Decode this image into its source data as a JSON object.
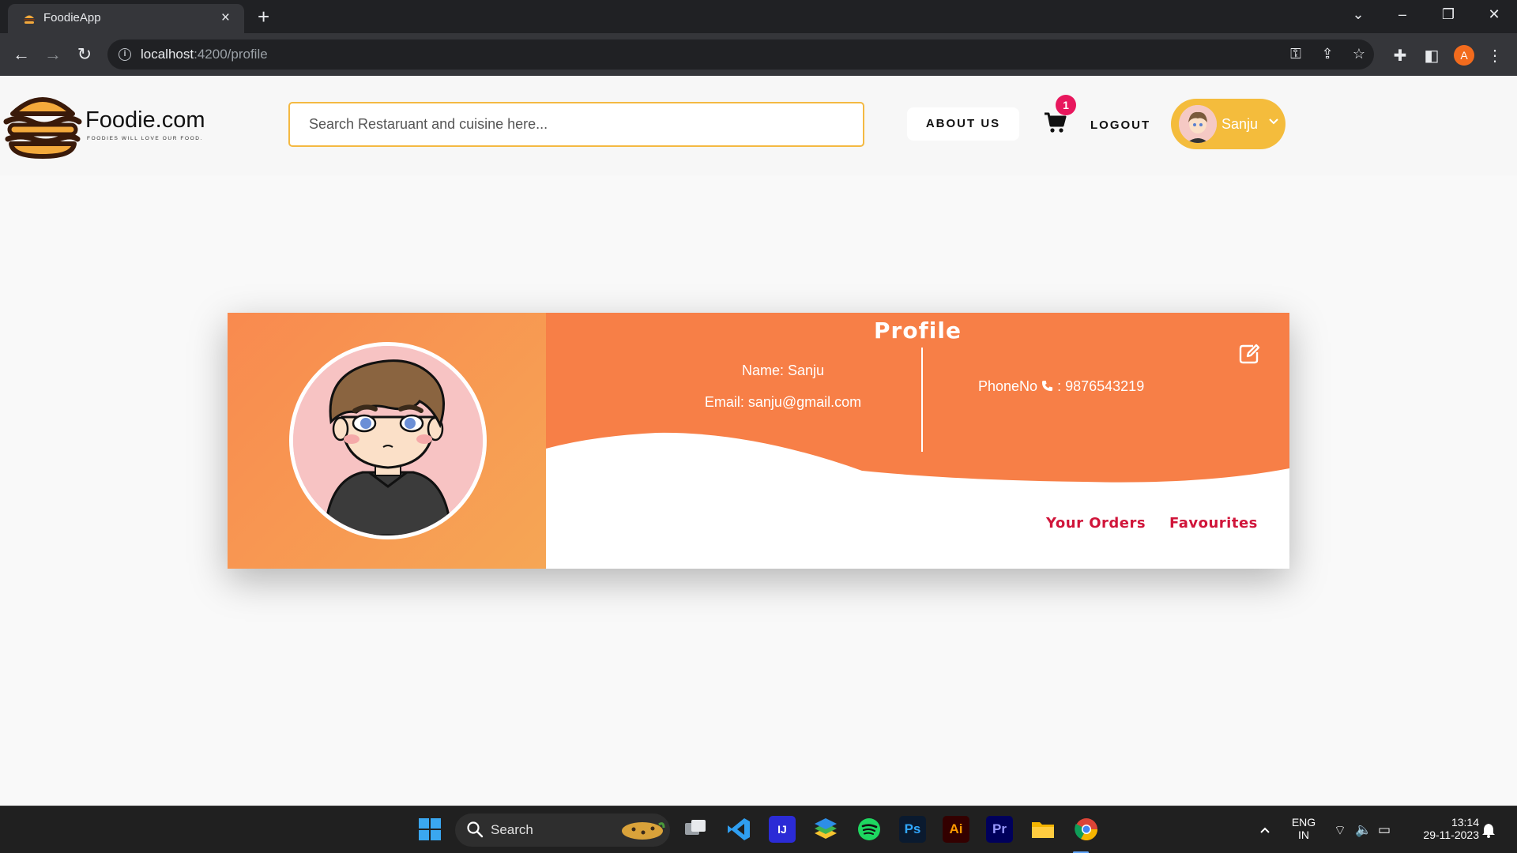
{
  "browser": {
    "tab_title": "FoodieApp",
    "url_host": "localhost",
    "url_path": ":4200/profile",
    "profile_initial": "A"
  },
  "header": {
    "brand_name": "Foodie.com",
    "brand_tagline": "FOODIES WILL LOVE OUR FOOD.",
    "search_placeholder": "Search Restaruant and cuisine here...",
    "about_label": "ABOUT US",
    "cart_count": "1",
    "logout_label": "LOGOUT",
    "user_name": "Sanju"
  },
  "profile": {
    "title": "Profile",
    "name_line": "Name: Sanju",
    "email_line": "Email: sanju@gmail.com",
    "phone_label": "PhoneNo",
    "phone_value": ": 9876543219",
    "tabs": [
      "Your Orders",
      "Favourites"
    ]
  },
  "taskbar": {
    "search_label": "Search",
    "language": "ENG",
    "region": "IN",
    "time": "13:14",
    "date": "29-11-2023",
    "apps": [
      "windows-start",
      "task-view",
      "vscode",
      "intellij",
      "bluestacks",
      "spotify",
      "photoshop",
      "illustrator",
      "premiere",
      "file-explorer",
      "chrome"
    ]
  },
  "colors": {
    "accent_orange": "#f77f47",
    "accent_yellow": "#f4bc3c",
    "link_red": "#d0153a",
    "badge_pink": "#e8175d"
  }
}
